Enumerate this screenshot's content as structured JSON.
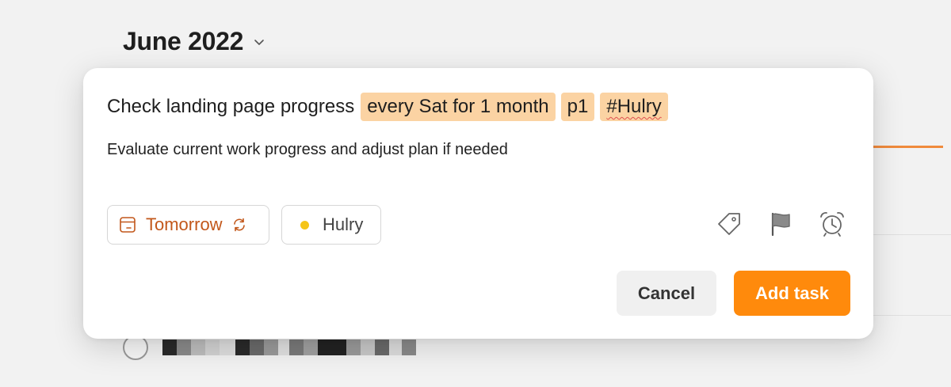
{
  "background": {
    "month_title": "June 2022"
  },
  "task": {
    "title": "Check landing page progress",
    "tokens": {
      "recurrence": "every Sat for 1 month",
      "priority": "p1",
      "project_tag": "#Hulry"
    },
    "description": "Evaluate current work progress and adjust plan if needed"
  },
  "chips": {
    "due_date": "Tomorrow",
    "project": "Hulry"
  },
  "buttons": {
    "cancel": "Cancel",
    "add_task": "Add task"
  },
  "colors": {
    "accent": "#ff8a0c",
    "token_highlight": "#fbd3a3",
    "date_text": "#c2571a",
    "project_dot": "#f5c518"
  },
  "icons": {
    "date_chip": "calendar-icon",
    "recurring": "repeat-icon",
    "project": "project-dot-icon",
    "label_action": "label-icon",
    "priority_action": "flag-icon",
    "reminder_action": "alarm-icon",
    "month_picker": "chevron-down-icon"
  }
}
